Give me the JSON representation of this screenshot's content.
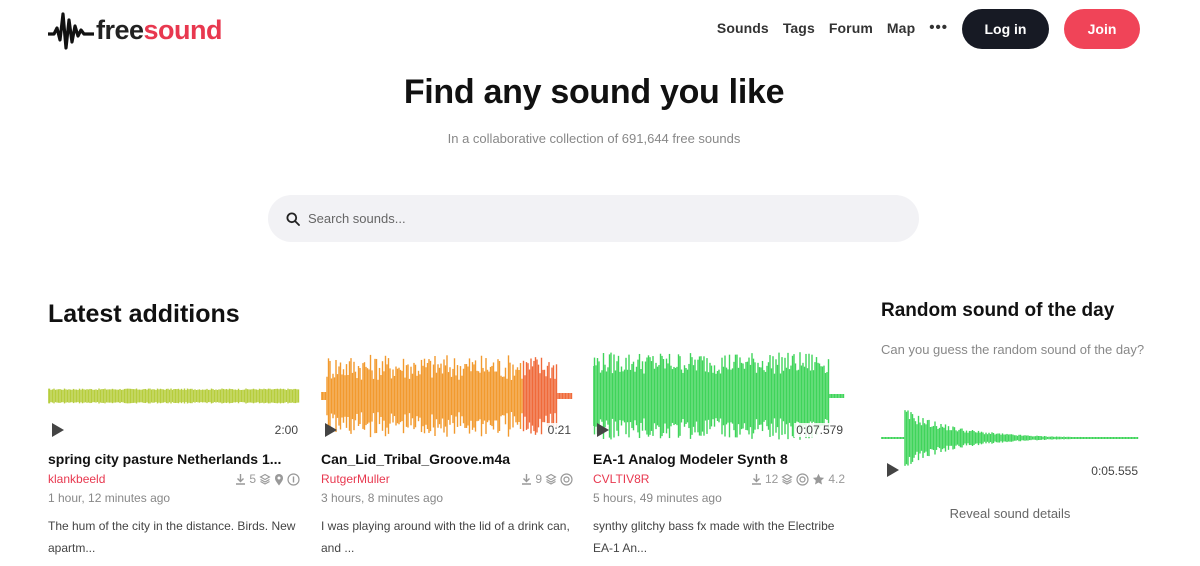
{
  "brand": {
    "logo_free": "free",
    "logo_sound": "sound",
    "logo_icon": "waveform-logo-icon",
    "colors": {
      "accent": "#e8384f",
      "dark_button": "#171a24",
      "join_button": "#f04458"
    }
  },
  "nav": {
    "items": [
      "Sounds",
      "Tags",
      "Forum",
      "Map"
    ],
    "more": "•••",
    "login": "Log in",
    "join": "Join"
  },
  "hero": {
    "title": "Find any sound you like",
    "subtitle": "In a collaborative collection of 691,644 free sounds",
    "search_placeholder": "Search sounds...",
    "search_icon": "search-icon"
  },
  "latest": {
    "title": "Latest additions",
    "items": [
      {
        "name": "spring city pasture Netherlands 1...",
        "user": "klankbeeld",
        "duration": "2:00",
        "downloads": "5",
        "time": "1 hour, 12 minutes ago",
        "description": "The hum of the city in the distance. Birds. New apartm...",
        "icons": [
          "download-icon",
          "layers-icon",
          "location-icon",
          "license-icon"
        ],
        "wave_color": "#b6cd3c"
      },
      {
        "name": "Can_Lid_Tribal_Groove.m4a",
        "user": "RutgerMuller",
        "duration": "0:21",
        "downloads": "9",
        "time": "3 hours, 8 minutes ago",
        "description": "I was playing around with the lid of a drink can, and ...",
        "icons": [
          "download-icon",
          "layers-icon",
          "license-icon"
        ],
        "wave_color": "#f29a2e"
      },
      {
        "name": "EA-1 Analog Modeler Synth 8",
        "user": "CVLTIV8R",
        "duration": "0:07.579",
        "downloads": "12",
        "rating": "4.2",
        "time": "5 hours, 49 minutes ago",
        "description": "synthy glitchy bass fx made with the Electribe EA-1 An...",
        "icons": [
          "download-icon",
          "layers-icon",
          "license-icon",
          "star-icon"
        ],
        "wave_color": "#3fd45a"
      }
    ]
  },
  "random": {
    "title": "Random sound of the day",
    "description": "Can you guess the random sound of the day?",
    "duration": "0:05.555",
    "reveal": "Reveal sound details",
    "wave_color": "#3fd45a"
  }
}
